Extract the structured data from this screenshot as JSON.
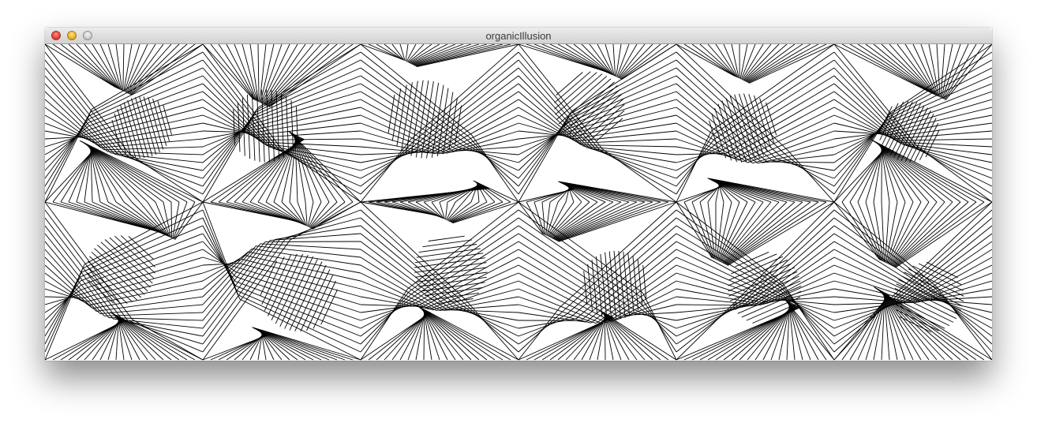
{
  "window": {
    "title": "organicIllusion"
  },
  "controls": {
    "close_icon": "close-icon",
    "minimize_icon": "minimize-icon",
    "zoom_icon": "zoom-icon"
  },
  "colors": {
    "stroke": "#000000",
    "background": "#ffffff"
  }
}
